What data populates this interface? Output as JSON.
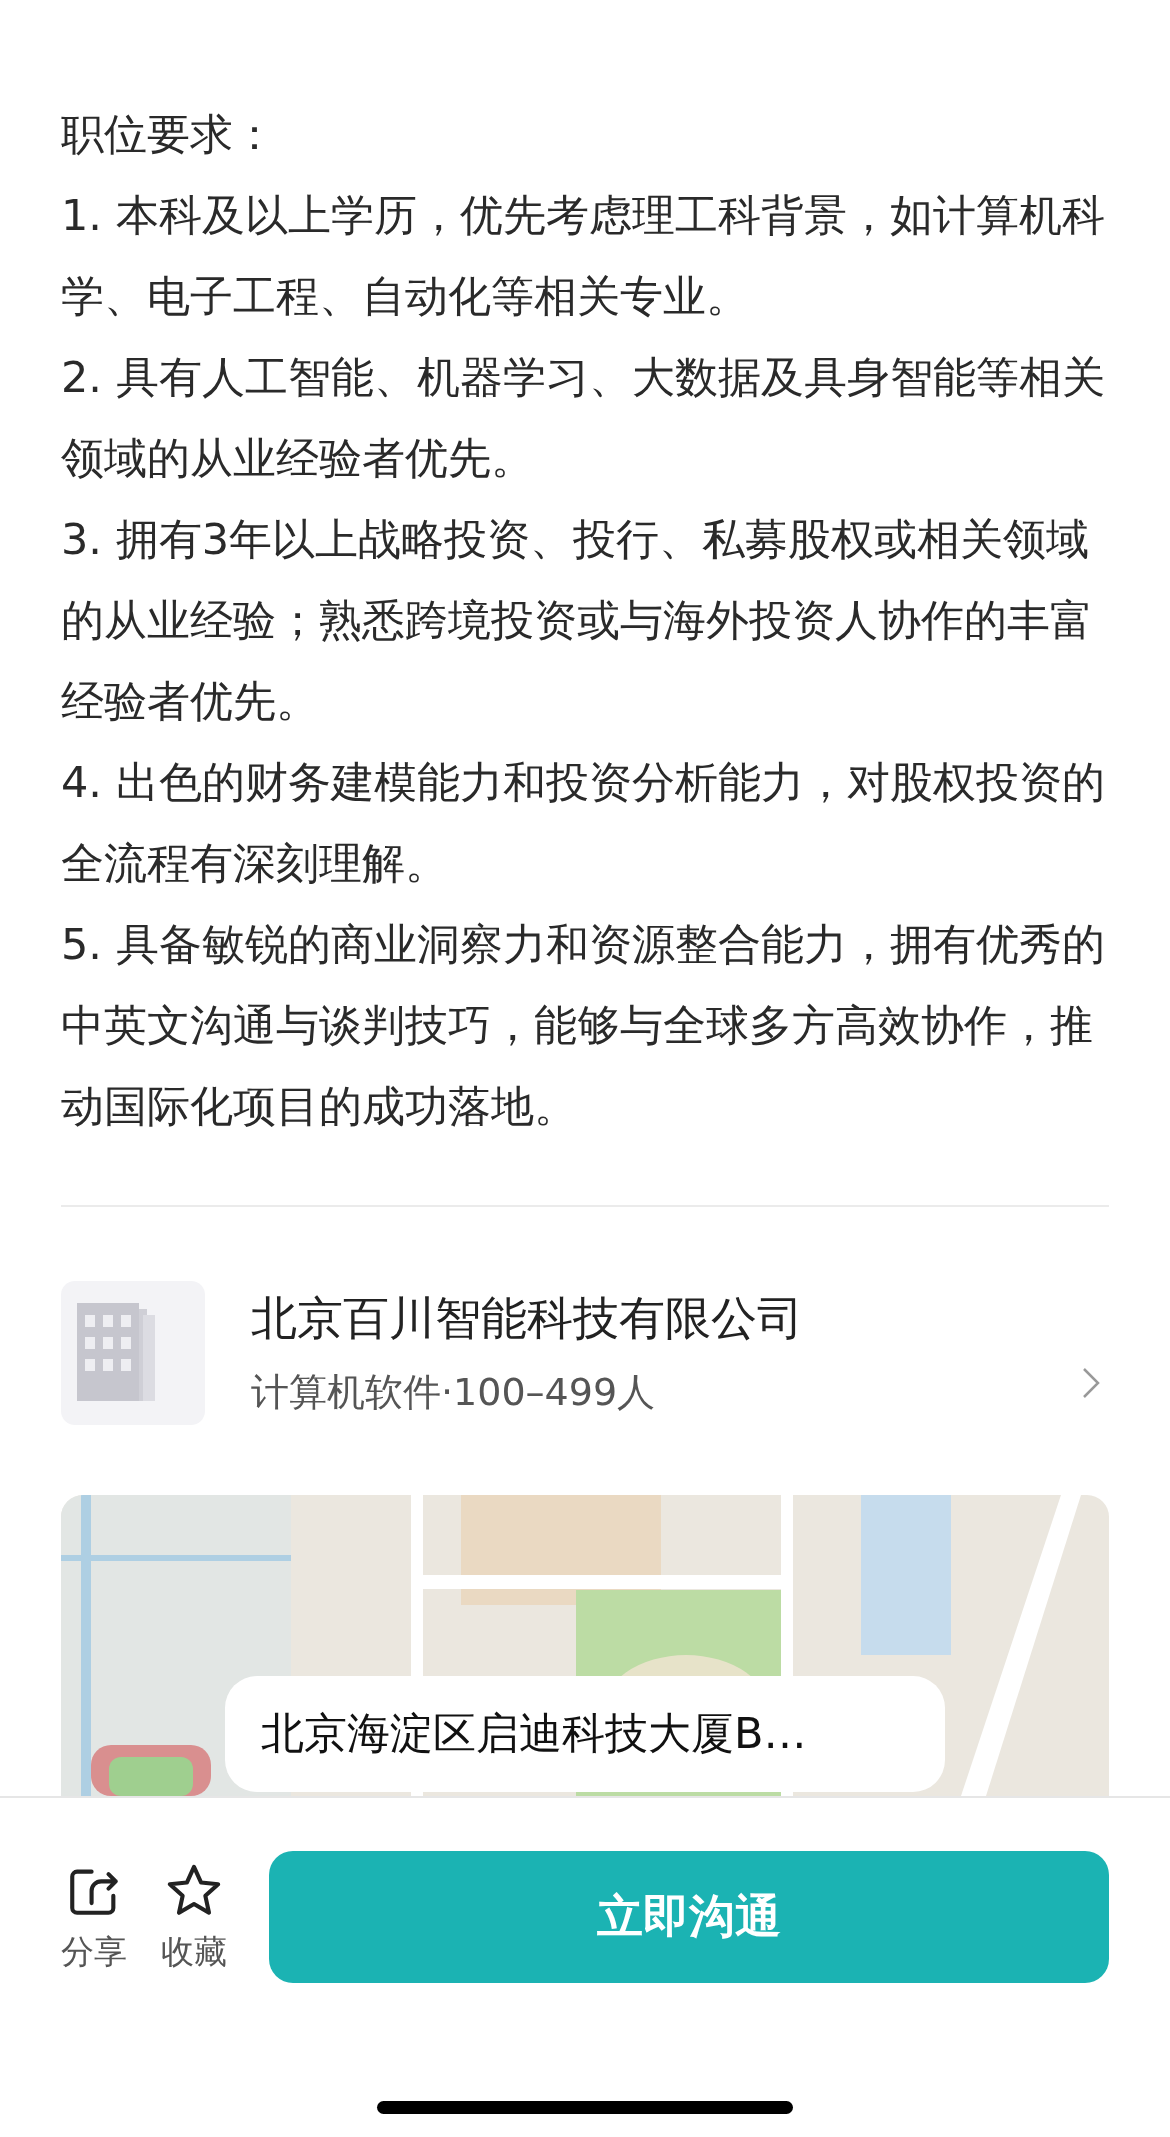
{
  "requirements": {
    "heading": "职位要求：",
    "items": [
      "1. 本科及以上学历，优先考虑理工科背景，如计算机科学、电子工程、自动化等相关专业。",
      "2. 具有人工智能、机器学习、大数据及具身智能等相关领域的从业经验者优先。",
      "3. 拥有3年以上战略投资、投行、私募股权或相关领域的从业经验；熟悉跨境投资或与海外投资人协作的丰富经验者优先。",
      "4. 出色的财务建模能力和投资分析能力，对股权投资的全流程有深刻理解。",
      "5. 具备敏锐的商业洞察力和资源整合能力，拥有优秀的中英文沟通与谈判技巧，能够与全球多方高效协作，推动国际化项目的成功落地。"
    ]
  },
  "company": {
    "name": "北京百川智能科技有限公司",
    "info": "计算机软件·100–499人"
  },
  "location": {
    "address": "北京海淀区启迪科技大厦B…"
  },
  "actions": [
    {
      "kind": "share",
      "label": "分享"
    },
    {
      "kind": "favorite",
      "label": "收藏"
    }
  ],
  "primary_button": "立即沟通"
}
